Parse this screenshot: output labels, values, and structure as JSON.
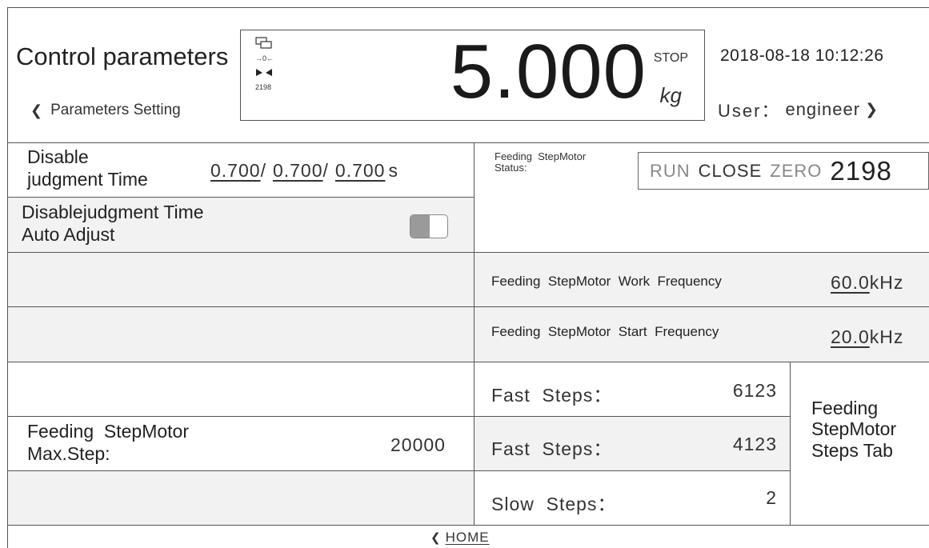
{
  "header": {
    "title": "Control parameters",
    "back_label": "Parameters Setting",
    "weight": "5.000",
    "state": "STOP",
    "unit": "kg",
    "zero_symbol": "→0←",
    "mini_count": "2198",
    "datetime": "2018-08-18 10:12:26",
    "user_label": "User：",
    "user_name": "engineer"
  },
  "left": {
    "disable_time_label_1": "Disable",
    "disable_time_label_2": "judgment Time",
    "disable_time_values": [
      "0.700",
      "0.700",
      "0.700"
    ],
    "disable_time_sep": "/",
    "disable_time_unit": "s",
    "auto_adjust_label_1": "Disablejudgment Time",
    "auto_adjust_label_2": "Auto Adjust",
    "auto_adjust_on": false,
    "max_step_label_1": "Feeding  StepMotor",
    "max_step_label_2": "Max.Step:",
    "max_step_value": "20000"
  },
  "right": {
    "status_label_1": "Feeding  StepMotor",
    "status_label_2": "Status:",
    "status_run": "RUN",
    "status_close": "CLOSE",
    "status_zero": "ZERO",
    "status_count": "2198",
    "work_freq_label": "Feeding  StepMotor  Work  Frequency",
    "work_freq_value": "60.0",
    "work_freq_unit": "kHz",
    "start_freq_label": "Feeding  StepMotor  Start  Frequency",
    "start_freq_value": "20.0",
    "start_freq_unit": "kHz",
    "steps": [
      {
        "label": "Fast  Steps：",
        "value": "6123"
      },
      {
        "label": "Fast  Steps：",
        "value": "4123"
      },
      {
        "label": "Slow  Steps：",
        "value": "2"
      }
    ],
    "steps_tab_1": "Feeding",
    "steps_tab_2": "StepMotor",
    "steps_tab_3": "Steps Tab"
  },
  "footer": {
    "home_label": "HOME"
  }
}
